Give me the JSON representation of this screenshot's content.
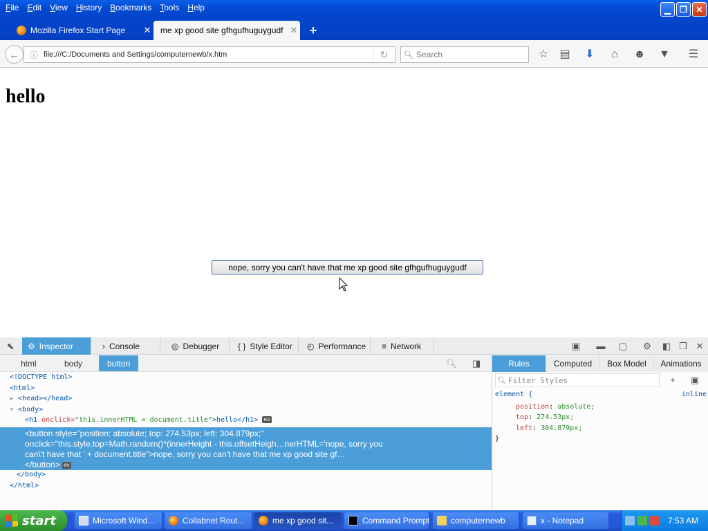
{
  "menu": [
    "File",
    "Edit",
    "View",
    "History",
    "Bookmarks",
    "Tools",
    "Help"
  ],
  "tabs": [
    {
      "label": "Mozilla Firefox Start Page"
    },
    {
      "label": "me xp good site gfhgufhuguygudf"
    }
  ],
  "nav": {
    "url": "file:///C:/Documents and Settings/computernewb/x.htm",
    "search_placeholder": "Search"
  },
  "page": {
    "heading": "hello",
    "button_label": "nope, sorry you can't have that me xp good site gfhgufhuguygudf"
  },
  "devtools": {
    "tabs": [
      "Inspector",
      "Console",
      "Debugger",
      "Style Editor",
      "Performance",
      "Network"
    ],
    "breadcrumbs": [
      "html",
      "body",
      "button"
    ],
    "markup": {
      "doctype": "<!DOCTYPE html>",
      "html_open": "<html>",
      "head": "<head></head>",
      "body_open": "<body>",
      "h1_tag": "<h1 ",
      "h1_attr": "onclick=",
      "h1_val": "\"this.innerHTML = document.title\"",
      "h1_text": ">hello</h1>",
      "btn_line1": "<button style=\"position: absolute; top: 274.53px; left: 304.879px;\"",
      "btn_line2": "onclick=\"this.style.top=Math.random()*(innerHeight - this.offsetHeigh…nerHTML='nope, sorry you",
      "btn_line3": "can\\'t have that ' + document.title\">nope, sorry you can't have that me xp good site gf…",
      "btn_close": "</button>",
      "body_close": "</body>",
      "html_close": "</html>",
      "ev_badge": "ev"
    },
    "rules_tabs": [
      "Rules",
      "Computed",
      "Box Model",
      "Animations"
    ],
    "filter_placeholder": "Filter Styles",
    "rule": {
      "selector": "element {",
      "source": "inline",
      "props": [
        {
          "name": "position",
          "value": "absolute;"
        },
        {
          "name": "top",
          "value": "274.53px;"
        },
        {
          "name": "left",
          "value": "304.879px;"
        }
      ],
      "close": "}"
    }
  },
  "taskbar": {
    "start_label": "start",
    "items": [
      "Microsoft Wind...",
      "Collabnet Rout...",
      "me xp good sit...",
      "Command Prompt",
      "computernewb",
      "x - Notepad"
    ],
    "clock": "7:53 AM"
  },
  "colors": {
    "xp_blue": "#0348d0",
    "devtools_accent": "#4c9ed9",
    "start_green": "#2c8c2c"
  }
}
